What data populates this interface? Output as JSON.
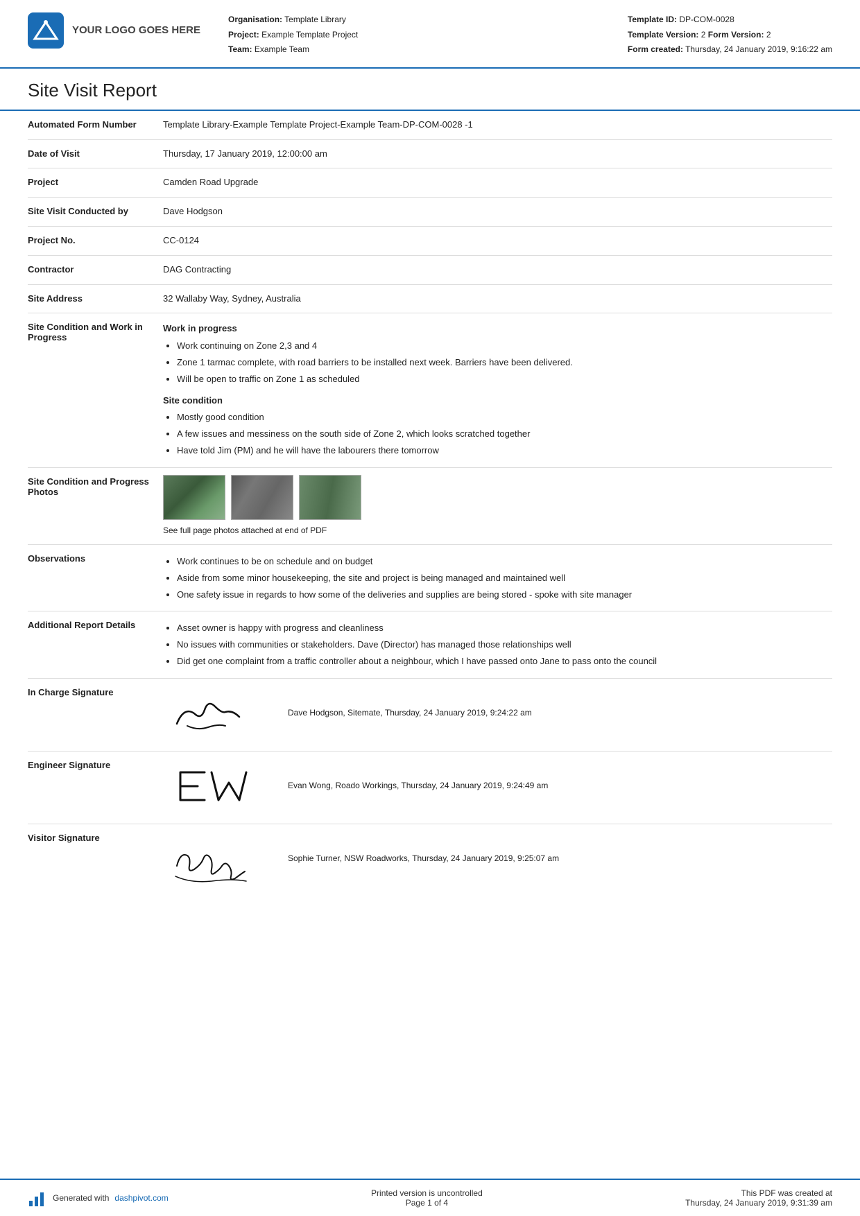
{
  "header": {
    "logo_text": "YOUR LOGO GOES HERE",
    "org_label": "Organisation:",
    "org_value": "Template Library",
    "project_label": "Project:",
    "project_value": "Example Template Project",
    "team_label": "Team:",
    "team_value": "Example Team",
    "template_id_label": "Template ID:",
    "template_id_value": "DP-COM-0028",
    "template_version_label": "Template Version:",
    "template_version_value": "2",
    "form_version_label": "Form Version:",
    "form_version_value": "2",
    "form_created_label": "Form created:",
    "form_created_value": "Thursday, 24 January 2019, 9:16:22 am"
  },
  "report": {
    "title": "Site Visit Report",
    "fields": [
      {
        "label": "Automated Form Number",
        "value": "Template Library-Example Template Project-Example Team-DP-COM-0028   -1"
      },
      {
        "label": "Date of Visit",
        "value": "Thursday, 17 January 2019, 12:00:00 am"
      },
      {
        "label": "Project",
        "value": "Camden Road Upgrade"
      },
      {
        "label": "Site Visit Conducted by",
        "value": "Dave Hodgson"
      },
      {
        "label": "Project No.",
        "value": "CC-0124"
      },
      {
        "label": "Contractor",
        "value": "DAG Contracting"
      },
      {
        "label": "Site Address",
        "value": "32 Wallaby Way, Sydney, Australia"
      }
    ],
    "site_condition_label": "Site Condition and Work in Progress",
    "site_condition_heading1": "Work in progress",
    "site_condition_items1": [
      "Work continuing on Zone 2,3 and 4",
      "Zone 1 tarmac complete, with road barriers to be installed next week. Barriers have been delivered.",
      "Will be open to traffic on Zone 1 as scheduled"
    ],
    "site_condition_heading2": "Site condition",
    "site_condition_items2": [
      "Mostly good condition",
      "A few issues and messiness on the south side of Zone 2, which looks scratched together",
      "Have told Jim (PM) and he will have the labourers there tomorrow"
    ],
    "photos_label": "Site Condition and Progress Photos",
    "photos_caption": "See full page photos attached at end of PDF",
    "observations_label": "Observations",
    "observations_items": [
      "Work continues to be on schedule and on budget",
      "Aside from some minor housekeeping, the site and project is being managed and maintained well",
      "One safety issue in regards to how some of the deliveries and supplies are being stored - spoke with site manager"
    ],
    "additional_label": "Additional Report Details",
    "additional_items": [
      "Asset owner is happy with progress and cleanliness",
      "No issues with communities or stakeholders. Dave (Director) has managed those relationships well",
      "Did get one complaint from a traffic controller about a neighbour, which I have passed onto Jane to pass onto the council"
    ],
    "sig_incharge_label": "In Charge Signature",
    "sig_incharge_meta": "Dave Hodgson, Sitemate, Thursday, 24 January 2019, 9:24:22 am",
    "sig_engineer_label": "Engineer Signature",
    "sig_engineer_meta": "Evan Wong, Roado Workings, Thursday, 24 January 2019, 9:24:49 am",
    "sig_visitor_label": "Visitor Signature",
    "sig_visitor_meta": "Sophie Turner, NSW Roadworks, Thursday, 24 January 2019, 9:25:07 am"
  },
  "footer": {
    "generated_text": "Generated with",
    "generated_link": "dashpivot.com",
    "page_text": "Printed version is uncontrolled",
    "page_number": "Page 1 of 4",
    "pdf_created_label": "This PDF was created at",
    "pdf_created_value": "Thursday, 24 January 2019, 9:31:39 am"
  }
}
